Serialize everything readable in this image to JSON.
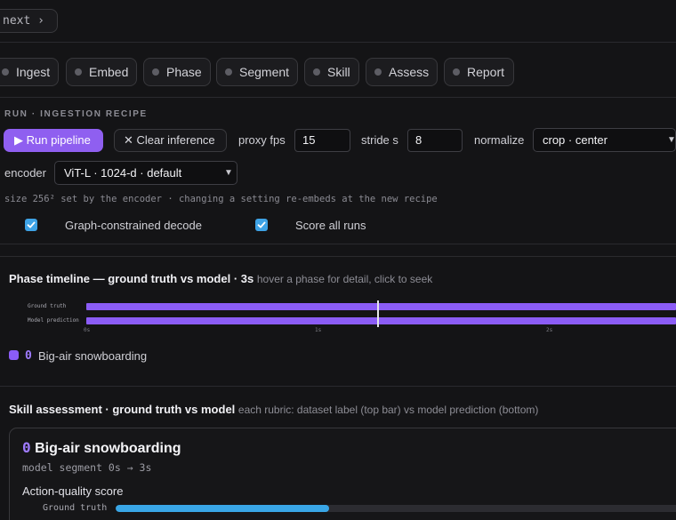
{
  "topbar": {
    "next_label": "next ›"
  },
  "stages": [
    "Ingest",
    "Embed",
    "Phase",
    "Segment",
    "Skill",
    "Assess",
    "Report"
  ],
  "recipe": {
    "title": "RUN · INGESTION RECIPE",
    "run_button": "▶ Run pipeline",
    "clear_button": "✕ Clear inference",
    "proxy_fps_label": "proxy fps",
    "proxy_fps_value": "15",
    "stride_label": "stride s",
    "stride_value": "8",
    "normalize_label": "normalize",
    "normalize_value": "crop · center",
    "encoder_label": "encoder",
    "encoder_value": "ViT-L · 1024-d · default",
    "hint": "size 256² set by the encoder · changing a setting re-embeds at the new recipe",
    "checkbox_graph": {
      "label": "Graph-constrained decode",
      "checked": true
    },
    "checkbox_score": {
      "label": "Score all runs",
      "checked": true
    }
  },
  "phase_timeline": {
    "title": "Phase timeline — ground truth vs model · 3s",
    "subtitle": "hover a phase for detail, click to seek",
    "row_ground_truth": "Ground truth",
    "row_model": "Model prediction",
    "ticks": [
      "0s",
      "1s",
      "2s"
    ],
    "legend_index": "0",
    "legend_label": "Big-air snowboarding",
    "phase_color": "#8b5cf6"
  },
  "skill": {
    "title": "Skill assessment · ground truth vs model",
    "subtitle": "each rubric: dataset label (top bar) vs model prediction (bottom)",
    "card_index": "0",
    "card_title": "Big-air snowboarding",
    "card_segment": "model segment 0s → 3s",
    "score_label": "Action-quality score",
    "ground_truth_label": "Ground truth",
    "ground_truth_fraction": 0.375,
    "bar_color": "#39a6e6"
  }
}
